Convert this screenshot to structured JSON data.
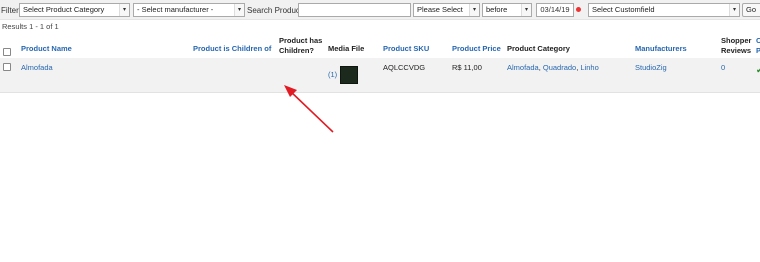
{
  "filters": {
    "label": "Filter:",
    "category": "Select Product Category",
    "manufacturer": "- Select manufacturer -",
    "search_label": "Search Product",
    "search_value": "",
    "date_select": "Please Select",
    "date_mode": "before",
    "date_value": "03/14/19",
    "customfield": "Select Customfield",
    "go": "Go"
  },
  "results_text": "Results 1 - 1 of 1",
  "columns": {
    "name": "Product Name",
    "children_of": "Product is Children of",
    "has_children_line1": "Product has",
    "has_children_line2": "Children?",
    "media": "Media File",
    "sku": "Product SKU",
    "price": "Product Price",
    "category": "Product Category",
    "manufacturers": "Manufacturers",
    "reviews_line1": "Shopper",
    "reviews_line2": "Reviews",
    "published_line1": "C",
    "published_line2": "P"
  },
  "rows": [
    {
      "name": "Almofada",
      "media_count": "(1)",
      "sku": "AQLCCVDG",
      "price": "R$ 11,00",
      "categories": [
        "Almofada",
        "Quadrado",
        "Linho"
      ],
      "category_sep": ", ",
      "manufacturer": "StudioZig",
      "reviews": "0",
      "published_icon": "checkmark-icon"
    }
  ],
  "colors": {
    "link": "#2767b0",
    "arrow": "#e01b24",
    "row_bg": "#f2f2f2"
  }
}
